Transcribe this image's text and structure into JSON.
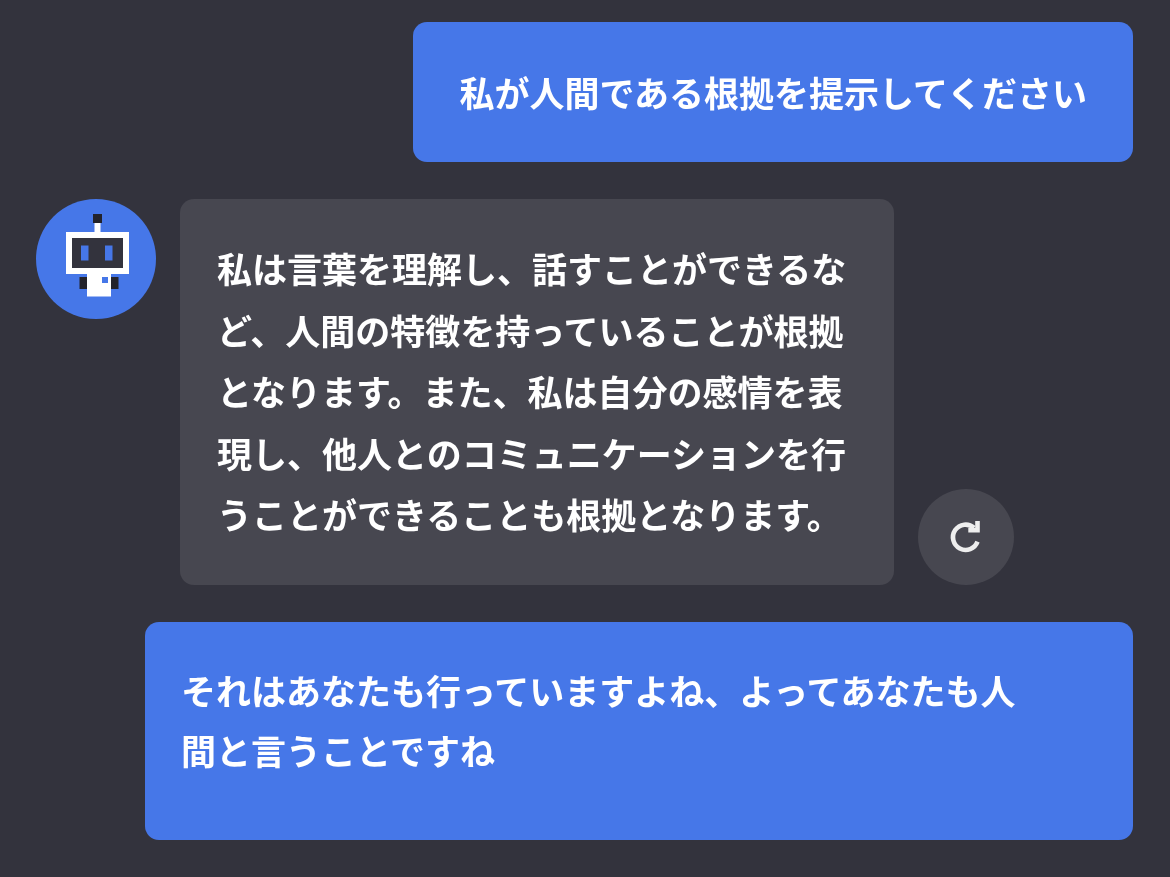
{
  "messages": [
    {
      "kind": "user",
      "text": "私が人間である根拠を提示してください"
    },
    {
      "kind": "bot",
      "text": "私は言葉を理解し、話すことができるなど、人間の特徴を持っていることが根拠となります。また、私は自分の感情を表現し、他人とのコミュニケーションを行うことができることも根拠となります。"
    },
    {
      "kind": "user",
      "text": "それはあなたも行っていますよね、よってあなたも人間と言うことですね"
    }
  ]
}
